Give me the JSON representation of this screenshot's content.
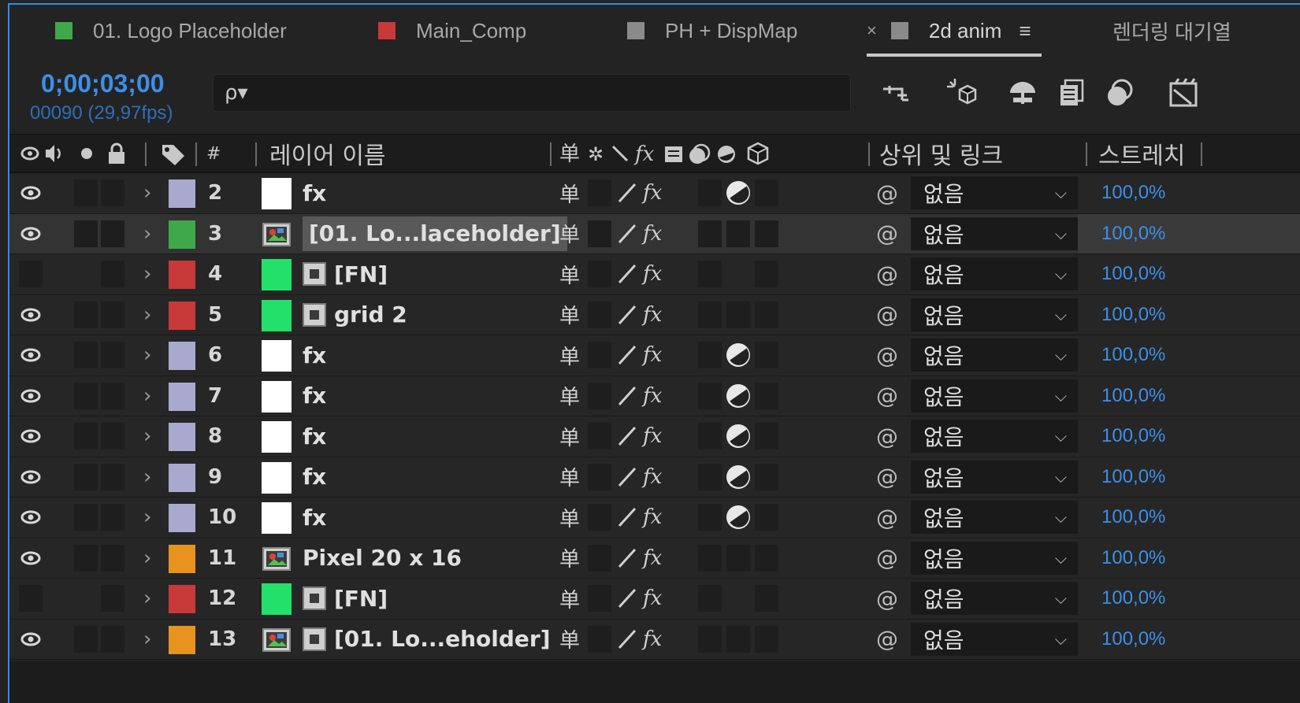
{
  "tabs": [
    {
      "label": "01. Logo Placeholder",
      "color": "#3ea84a"
    },
    {
      "label": "Main_Comp",
      "color": "#c8393a"
    },
    {
      "label": "PH + DispMap",
      "color": "#8a8a8a"
    },
    {
      "label": "2d anim",
      "color": "#8a8a8a",
      "active": true,
      "close": "×",
      "menu": "≡"
    },
    {
      "label": "렌더링 대기열"
    }
  ],
  "timecode": "0;00;03;00",
  "frame_info": "00090 (29,97fps)",
  "search": {
    "placeholder": "",
    "icon": "ρ▾"
  },
  "toolbar_icons": [
    "draft-3d-icon",
    "shy-layers-icon",
    "motion-blur-icon",
    "frame-blending-icon",
    "graph-editor-icon",
    "render-icon"
  ],
  "columns": {
    "av_icons": "◉🔈●🔒",
    "label_icon": "🏷",
    "num": "#",
    "layer_name": "레이어 이름",
    "switches": "单✲＼fx▣◎◑⬡",
    "parent": "상위 및 링크",
    "stretch": "스트레치"
  },
  "layers": [
    {
      "num": "2",
      "label_color": "#a9a9cf",
      "thumb_color": "#ffffff",
      "eye": true,
      "name": "fx",
      "icons": [],
      "motion": true
    },
    {
      "num": "3",
      "label_color": "#3ea84a",
      "thumb_color": "footage",
      "eye": true,
      "name": "[01. Lo...laceholder]",
      "icons": [],
      "motion": false,
      "selected": true
    },
    {
      "num": "4",
      "label_color": "#c8393a",
      "thumb_color": "#22e06a",
      "eye": false,
      "name": "[FN]",
      "icons": [
        "null"
      ],
      "motion": false
    },
    {
      "num": "5",
      "label_color": "#c8393a",
      "thumb_color": "#22e06a",
      "eye": true,
      "name": "grid 2",
      "icons": [
        "solid"
      ],
      "motion": false
    },
    {
      "num": "6",
      "label_color": "#a9a9cf",
      "thumb_color": "#ffffff",
      "eye": true,
      "name": "fx",
      "icons": [],
      "motion": true
    },
    {
      "num": "7",
      "label_color": "#a9a9cf",
      "thumb_color": "#ffffff",
      "eye": true,
      "name": "fx",
      "icons": [],
      "motion": true
    },
    {
      "num": "8",
      "label_color": "#a9a9cf",
      "thumb_color": "#ffffff",
      "eye": true,
      "name": "fx",
      "icons": [],
      "motion": true
    },
    {
      "num": "9",
      "label_color": "#a9a9cf",
      "thumb_color": "#ffffff",
      "eye": true,
      "name": "fx",
      "icons": [],
      "motion": true
    },
    {
      "num": "10",
      "label_color": "#a9a9cf",
      "thumb_color": "#ffffff",
      "eye": true,
      "name": "fx",
      "icons": [],
      "motion": true
    },
    {
      "num": "11",
      "label_color": "#e8931f",
      "thumb_color": "footage",
      "eye": true,
      "name": "Pixel 20 x 16",
      "icons": [],
      "motion": false
    },
    {
      "num": "12",
      "label_color": "#c8393a",
      "thumb_color": "#22e06a",
      "eye": false,
      "name": "[FN]",
      "icons": [
        "null"
      ],
      "motion": false
    },
    {
      "num": "13",
      "label_color": "#e8931f",
      "thumb_color": "footage",
      "eye": true,
      "name": "[01. Lo...eholder]",
      "icons": [
        "solid"
      ],
      "motion": false
    }
  ],
  "parent_value": "없음",
  "stretch_value": "100,0%",
  "accent_color": "#3c8fe8"
}
